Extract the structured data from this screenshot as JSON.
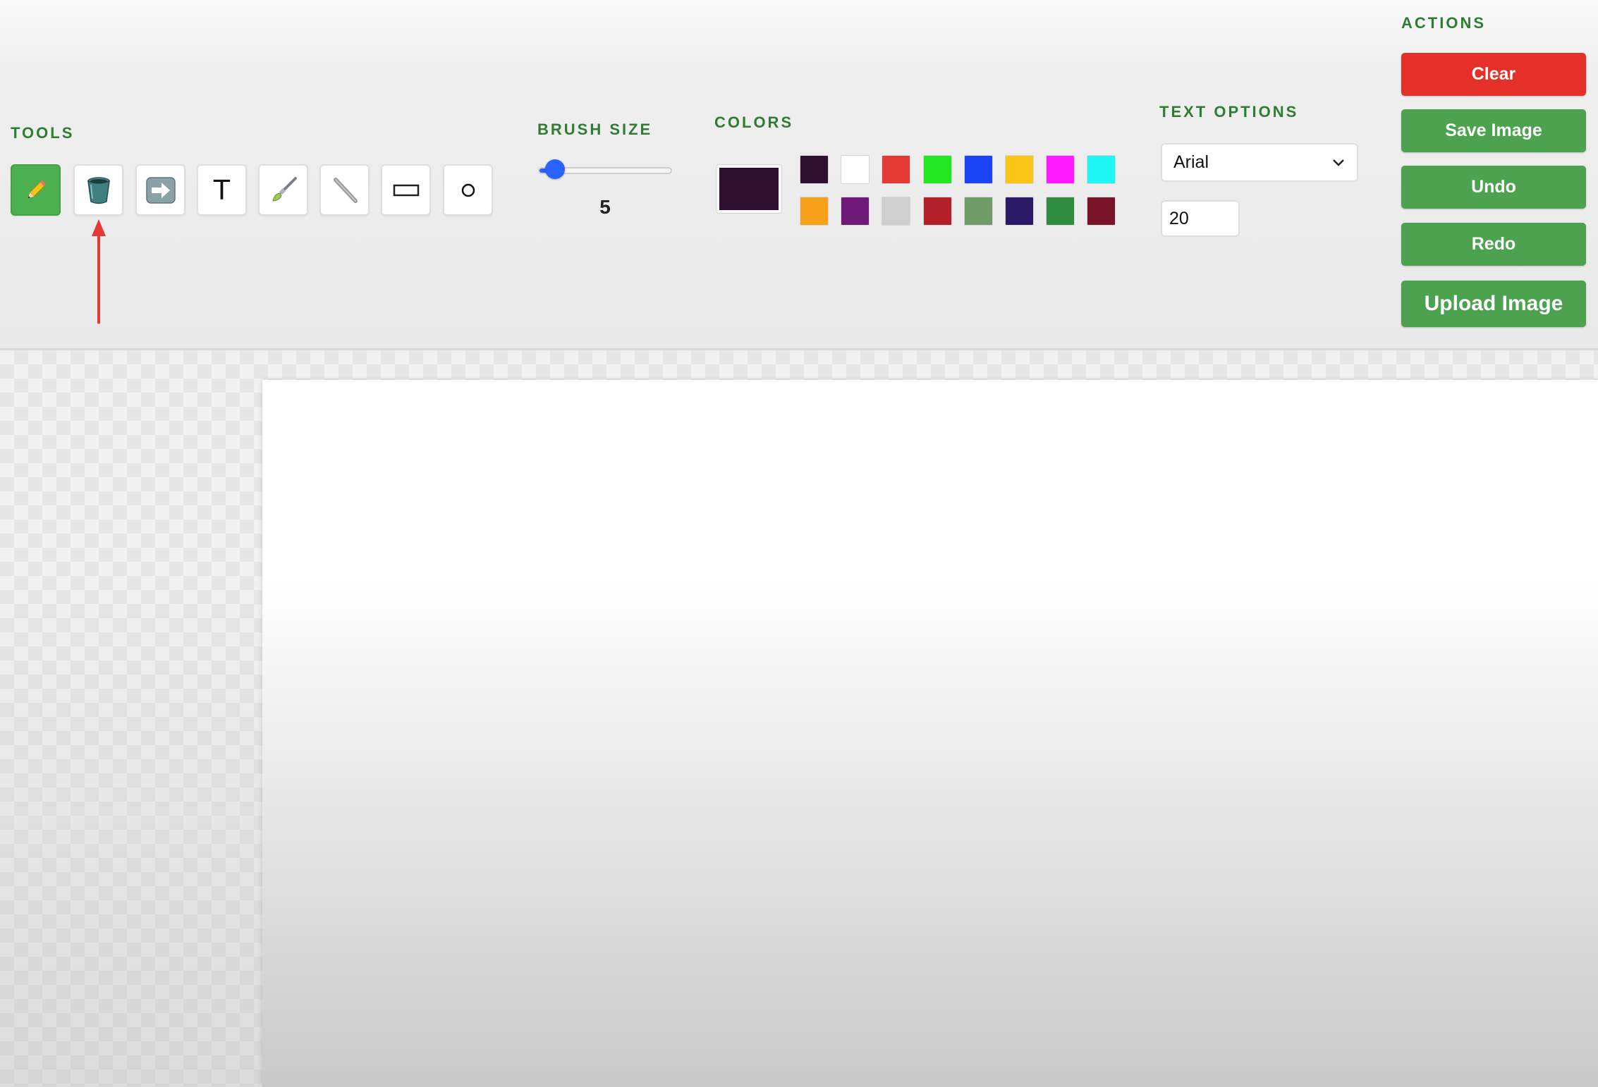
{
  "tools": {
    "title": "TOOLS",
    "items": [
      {
        "id": "pencil",
        "icon": "pencil-icon",
        "active": true
      },
      {
        "id": "fill",
        "icon": "paint-bucket-icon",
        "active": false
      },
      {
        "id": "arrow",
        "icon": "arrow-right-icon",
        "active": false
      },
      {
        "id": "text",
        "icon": "text-icon",
        "glyph": "T",
        "active": false
      },
      {
        "id": "brush",
        "icon": "paintbrush-icon",
        "active": false
      },
      {
        "id": "line",
        "icon": "line-icon",
        "active": false
      },
      {
        "id": "rectangle",
        "icon": "rectangle-icon",
        "active": false
      },
      {
        "id": "circle",
        "icon": "circle-icon",
        "glyph": "○",
        "active": false
      }
    ]
  },
  "brush": {
    "title": "BRUSH SIZE",
    "value": "5",
    "fraction": 0.05
  },
  "colors": {
    "title": "COLORS",
    "current": "#2e0f2e",
    "palette": [
      "#2e0f2e",
      "#ffffff",
      "#e53935",
      "#22e722",
      "#1a44f5",
      "#fbc518",
      "#ff1aff",
      "#1ff5f5",
      "#f6a21c",
      "#6e1a76",
      "#cfcfcf",
      "#b32029",
      "#6f9b66",
      "#2a1a66",
      "#2f8b3f",
      "#7a1428"
    ]
  },
  "text_options": {
    "title": "TEXT OPTIONS",
    "font": "Arial",
    "size": "20"
  },
  "actions": {
    "title": "ACTIONS",
    "clear": "Clear",
    "save": "Save Image",
    "undo": "Undo",
    "redo": "Redo",
    "upload": "Upload Image",
    "danger_color": "#e53029",
    "primary_color": "#4ca24f"
  },
  "theme": {
    "accent": "#2e7d32",
    "annotation": "#e53935"
  }
}
